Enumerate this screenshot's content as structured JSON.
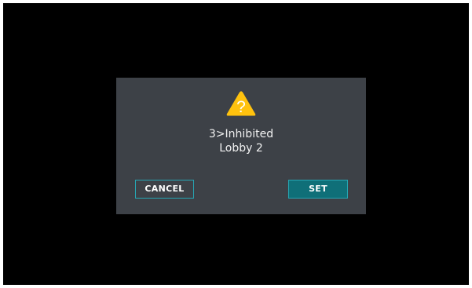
{
  "dialog": {
    "icon": "warning-triangle-icon",
    "icon_glyph": "?",
    "line1": "3>Inhibited",
    "line2": "Lobby 2",
    "cancel_label": "CANCEL",
    "set_label": "SET"
  },
  "colors": {
    "background": "#000000",
    "dialog": "#3d4147",
    "accent": "#26a6b4",
    "set_button": "#0f6f78",
    "warning": "#ffc20e"
  }
}
